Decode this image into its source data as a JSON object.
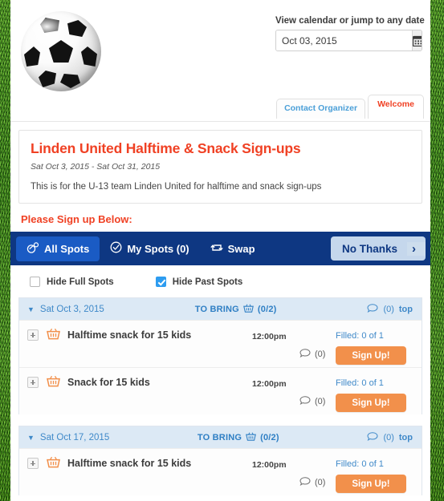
{
  "datejump": {
    "label": "View calendar or jump to any date",
    "value": "Oct 03, 2015",
    "placeholder": "Oct 03, 2015",
    "calendar_icon": "calendar-icon"
  },
  "top_tabs": [
    {
      "label": "Contact Organizer",
      "name": "contact-organizer"
    },
    {
      "label": "Welcome",
      "name": "welcome"
    }
  ],
  "info": {
    "title": "Linden United Halftime & Snack Sign-ups",
    "dates": "Sat Oct 3, 2015 - Sat Oct 31, 2015",
    "description": "This is for the U-13 team Linden United for halftime and snack sign-ups"
  },
  "please_signup": "Please Sign up Below:",
  "navbar": {
    "tabs": [
      {
        "label": "All Spots",
        "icon": "all-spots-icon",
        "active": true
      },
      {
        "label": "My Spots (0)",
        "icon": "check-circle-icon",
        "active": false
      },
      {
        "label": "Swap",
        "icon": "swap-icon",
        "active": false
      }
    ],
    "no_thanks": {
      "label": "No Thanks",
      "arrow": "›"
    }
  },
  "filters": [
    {
      "label": "Hide Full Spots",
      "checked": false,
      "name": "hide-full-spots"
    },
    {
      "label": "Hide Past Spots",
      "checked": true,
      "name": "hide-past-spots"
    }
  ],
  "groups": [
    {
      "date": "Sat Oct 3, 2015",
      "category": "TO BRING",
      "category_count": "(0/2)",
      "comment_count": "(0)",
      "top_link": "top",
      "slots": [
        {
          "title": "Halftime snack for 15 kids",
          "time": "12:00pm",
          "filled": "Filled: 0 of 1",
          "comments": "(0)",
          "button": "Sign Up!"
        },
        {
          "title": "Snack for 15 kids",
          "time": "12:00pm",
          "filled": "Filled: 0 of 1",
          "comments": "(0)",
          "button": "Sign Up!"
        }
      ]
    },
    {
      "date": "Sat Oct 17, 2015",
      "category": "TO BRING",
      "category_count": "(0/2)",
      "comment_count": "(0)",
      "top_link": "top",
      "slots": [
        {
          "title": "Halftime snack for 15 kids",
          "time": "12:00pm",
          "filled": "Filled: 0 of 1",
          "comments": "(0)",
          "button": "Sign Up!"
        }
      ]
    }
  ],
  "colors": {
    "brand_red": "#f04124",
    "navy": "#0e3782",
    "tab_blue": "#1a5bc4",
    "orange": "#f2904b",
    "link_blue": "#3f89c9",
    "group_header": "#dce9f5"
  }
}
